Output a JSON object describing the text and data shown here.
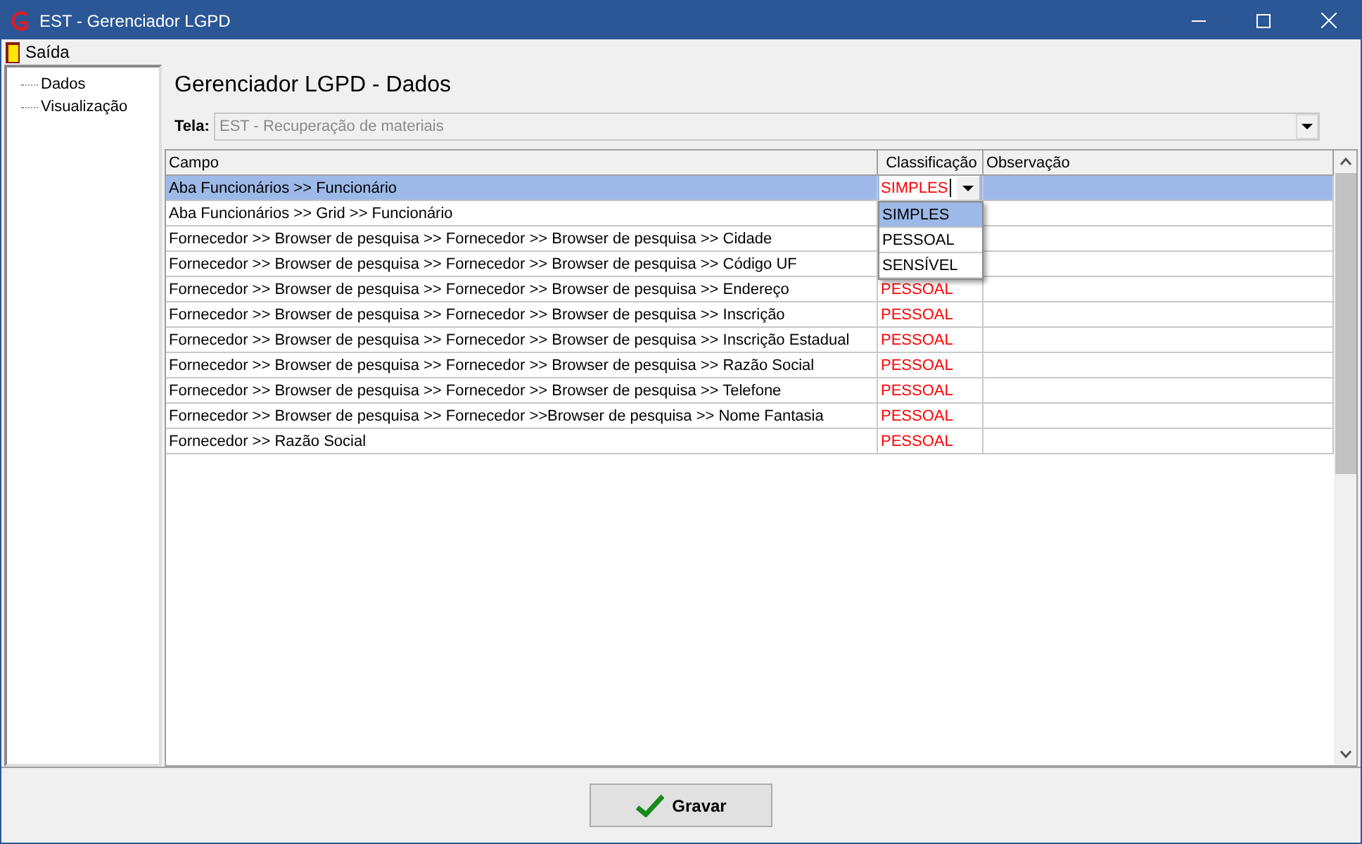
{
  "window": {
    "title": "EST - Gerenciador LGPD"
  },
  "menu": [
    {
      "label": "Saída"
    }
  ],
  "tree": [
    {
      "label": "Dados"
    },
    {
      "label": "Visualização"
    }
  ],
  "heading": "Gerenciador LGPD - Dados",
  "screen_field": {
    "label": "Tela:",
    "value": "EST - Recuperação de materiais",
    "disabled": true
  },
  "table": {
    "columns": [
      "Campo",
      "Classificação",
      "Observação"
    ],
    "rows": [
      {
        "campo": "Aba Funcionários >> Funcionário",
        "selected": true,
        "editing": true,
        "classificacao": "SIMPLES"
      },
      {
        "campo": "Aba Funcionários >> Grid >> Funcionário",
        "selected": false
      },
      {
        "campo": "Fornecedor >> Browser de pesquisa >> Fornecedor >> Browser de pesquisa >> Cidade",
        "selected": false
      },
      {
        "campo": "Fornecedor >> Browser de pesquisa >> Fornecedor >> Browser de pesquisa >> Código UF",
        "selected": false
      },
      {
        "campo": "Fornecedor >> Browser de pesquisa >> Fornecedor >> Browser de pesquisa >> Endereço",
        "selected": false,
        "classificacao": "PESSOAL"
      },
      {
        "campo": "Fornecedor >> Browser de pesquisa >> Fornecedor >> Browser de pesquisa >> Inscrição",
        "selected": false,
        "classificacao": "PESSOAL"
      },
      {
        "campo": "Fornecedor >> Browser de pesquisa >> Fornecedor >> Browser de pesquisa >> Inscrição Estadual",
        "selected": false,
        "classificacao": "PESSOAL"
      },
      {
        "campo": "Fornecedor >> Browser de pesquisa >> Fornecedor >> Browser de pesquisa >> Razão Social",
        "selected": false,
        "classificacao": "PESSOAL"
      },
      {
        "campo": "Fornecedor >> Browser de pesquisa >> Fornecedor >> Browser de pesquisa >> Telefone",
        "selected": false,
        "classificacao": "PESSOAL"
      },
      {
        "campo": "Fornecedor >> Browser de pesquisa >> Fornecedor >>Browser de pesquisa >> Nome Fantasia",
        "selected": false,
        "classificacao": "PESSOAL"
      },
      {
        "campo": "Fornecedor >> Razão Social",
        "selected": false,
        "classificacao": "PESSOAL"
      }
    ],
    "dropdown": {
      "options": [
        {
          "label": "SIMPLES",
          "selected": true
        },
        {
          "label": "PESSOAL",
          "selected": false
        },
        {
          "label": "SENSÍVEL",
          "selected": false
        }
      ]
    }
  },
  "buttons": [
    {
      "label": "Gravar"
    }
  ]
}
